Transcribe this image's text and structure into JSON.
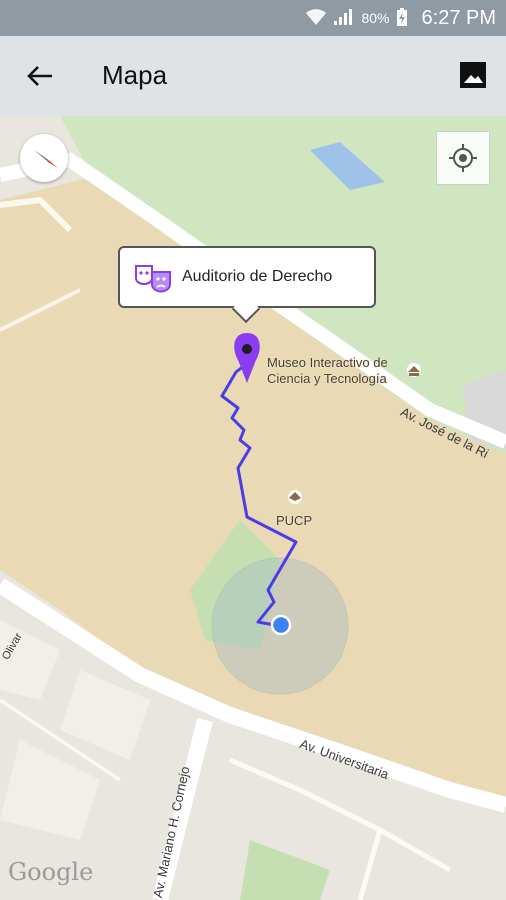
{
  "status": {
    "battery": "80%",
    "time": "6:27 PM"
  },
  "appbar": {
    "title": "Mapa"
  },
  "map": {
    "callout_title": "Auditorio de Derecho",
    "poi_museum_line1": "Museo Interactivo de",
    "poi_museum_line2": "Ciencia y Tecnología",
    "poi_pucp": "PUCP",
    "road_jose": "Av. José de la Ri",
    "road_universitaria": "Av. Universitaria",
    "road_mariano": "Av. Mariano H. Cornejo",
    "road_olivar": "Olivar",
    "attribution": "Google"
  },
  "colors": {
    "route": "#4c3be8",
    "marker": "#8a3cf0",
    "location": "#3b82f6",
    "campus": "#e9d9b4",
    "park": "#cfe6c0"
  }
}
